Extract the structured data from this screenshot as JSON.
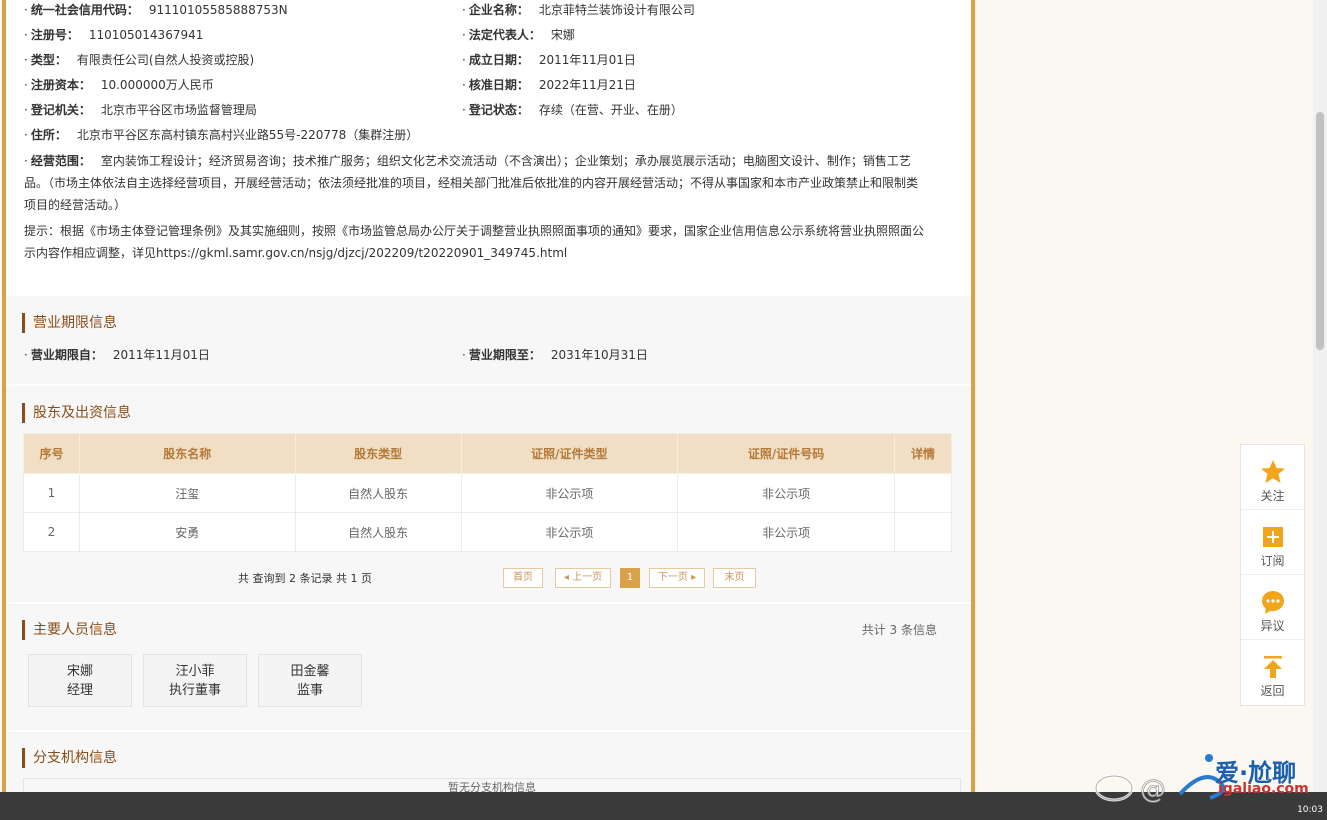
{
  "basic_info": {
    "credit_code": {
      "label": "统一社会信用代码：",
      "value": "91110105585888753N"
    },
    "company_name": {
      "label": "企业名称：",
      "value": "北京菲特兰装饰设计有限公司"
    },
    "reg_no": {
      "label": "注册号：",
      "value": "110105014367941"
    },
    "legal_rep": {
      "label": "法定代表人：",
      "value": "宋娜"
    },
    "type": {
      "label": "类型：",
      "value": "有限责任公司(自然人投资或控股)"
    },
    "founded": {
      "label": "成立日期：",
      "value": "2011年11月01日"
    },
    "capital": {
      "label": "注册资本：",
      "value": "10.000000万人民币"
    },
    "approved": {
      "label": "核准日期：",
      "value": "2022年11月21日"
    },
    "authority": {
      "label": "登记机关：",
      "value": "北京市平谷区市场监督管理局"
    },
    "status": {
      "label": "登记状态：",
      "value": "存续（在营、开业、在册）"
    },
    "address": {
      "label": "住所：",
      "value": "北京市平谷区东高村镇东高村兴业路55号-220778（集群注册）"
    },
    "scope_label": "经营范围：",
    "scope_line1": "室内装饰工程设计；经济贸易咨询；技术推广服务；组织文化艺术交流活动（不含演出）；企业策划；承办展览展示活动；电脑图文设计、制作；销售工艺",
    "scope_line2": "品。（市场主体依法自主选择经营项目，开展经营活动；依法须经批准的项目，经相关部门批准后依批准的内容开展经营活动；不得从事国家和本市产业政策禁止和限制类",
    "scope_line3": "项目的经营活动。）",
    "tip_line1": "提示：根据《市场主体登记管理条例》及其实施细则，按照《市场监管总局办公厅关于调整营业执照照面事项的通知》要求，国家企业信用信息公示系统将营业执照照面公",
    "tip_line2": "示内容作相应调整，详见https://gkml.samr.gov.cn/nsjg/djzcj/202209/t20220901_349745.html"
  },
  "term": {
    "title": "营业期限信息",
    "from": {
      "label": "营业期限自：",
      "value": "2011年11月01日"
    },
    "to": {
      "label": "营业期限至：",
      "value": "2031年10月31日"
    }
  },
  "shareholders": {
    "title": "股东及出资信息",
    "headers": [
      "序号",
      "股东名称",
      "股东类型",
      "证照/证件类型",
      "证照/证件号码",
      "详情"
    ],
    "rows": [
      [
        "1",
        "汪玺",
        "自然人股东",
        "非公示项",
        "非公示项",
        ""
      ],
      [
        "2",
        "安勇",
        "自然人股东",
        "非公示项",
        "非公示项",
        ""
      ]
    ],
    "summary": "共 查询到 2 条记录 共 1 页",
    "pager": {
      "first": "首页",
      "prev": "◂ 上一页",
      "current": "1",
      "next": "下一页 ▸",
      "last": "末页"
    }
  },
  "personnel": {
    "title": "主要人员信息",
    "count": "共计 3 条信息",
    "people": [
      {
        "name": "宋娜",
        "role": "经理"
      },
      {
        "name": "汪小菲",
        "role": "执行董事"
      },
      {
        "name": "田金馨",
        "role": "监事"
      }
    ]
  },
  "branches": {
    "title": "分支机构信息",
    "empty": "暂无分支机构信息"
  },
  "float_menu": [
    {
      "label": "关注",
      "icon": "star-icon"
    },
    {
      "label": "订阅",
      "icon": "plus-square-icon"
    },
    {
      "label": "异议",
      "icon": "chat-bubble-icon"
    },
    {
      "label": "返回",
      "icon": "arrow-up-icon"
    }
  ],
  "watermark": {
    "text": "爱·尬聊",
    "url": "igaliao.com"
  },
  "clock": "10:03",
  "colors": {
    "accent": "#d9a14a",
    "title": "#8a4d1a",
    "table_header": "#f0dfc4"
  }
}
